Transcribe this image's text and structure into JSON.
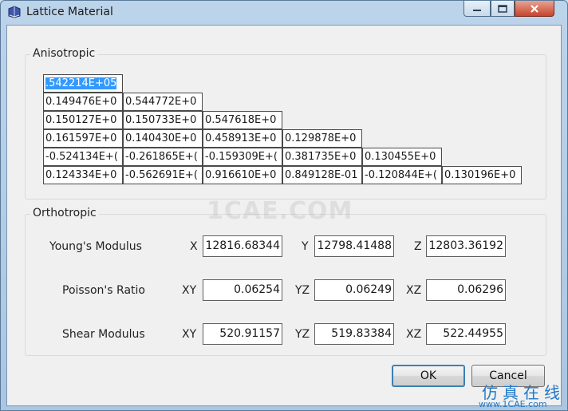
{
  "window": {
    "title": "Lattice Material"
  },
  "anisotropic": {
    "label": "Anisotropic",
    "rows": [
      [
        ".542214E+05"
      ],
      [
        "0.149476E+0",
        "0.544772E+0"
      ],
      [
        "0.150127E+0",
        "0.150733E+0",
        "0.547618E+0"
      ],
      [
        "0.161597E+0",
        "0.140430E+0",
        "0.458913E+0",
        "0.129878E+0"
      ],
      [
        "-0.524134E+(",
        "-0.261865E+(",
        "-0.159309E+(",
        "0.381735E+0",
        "0.130455E+0"
      ],
      [
        "0.124334E+0",
        "-0.562691E+(",
        "0.916610E+0",
        "0.849128E-01",
        "-0.120844E+(",
        "0.130196E+0"
      ]
    ]
  },
  "orthotropic": {
    "label": "Orthotropic",
    "youngs": {
      "label": "Young's Modulus",
      "axes": [
        "X",
        "Y",
        "Z"
      ],
      "values": [
        "12816.68344",
        "12798.41488",
        "12803.36192"
      ]
    },
    "poisson": {
      "label": "Poisson's Ratio",
      "axes": [
        "XY",
        "YZ",
        "XZ"
      ],
      "values": [
        "0.06254",
        "0.06249",
        "0.06296"
      ]
    },
    "shear": {
      "label": "Shear Modulus",
      "axes": [
        "XY",
        "YZ",
        "XZ"
      ],
      "values": [
        "520.91157",
        "519.83384",
        "522.44955"
      ]
    }
  },
  "buttons": {
    "ok": "OK",
    "cancel": "Cancel"
  },
  "watermark": "1CAE.COM",
  "corner_logo": {
    "text": "仿真在线",
    "url": "www.1CAE.com"
  },
  "colors": {
    "selection": "#3399ff",
    "title_bar": "#bcd4ea",
    "close_button": "#c6442d",
    "logo": "#1f78c8"
  }
}
